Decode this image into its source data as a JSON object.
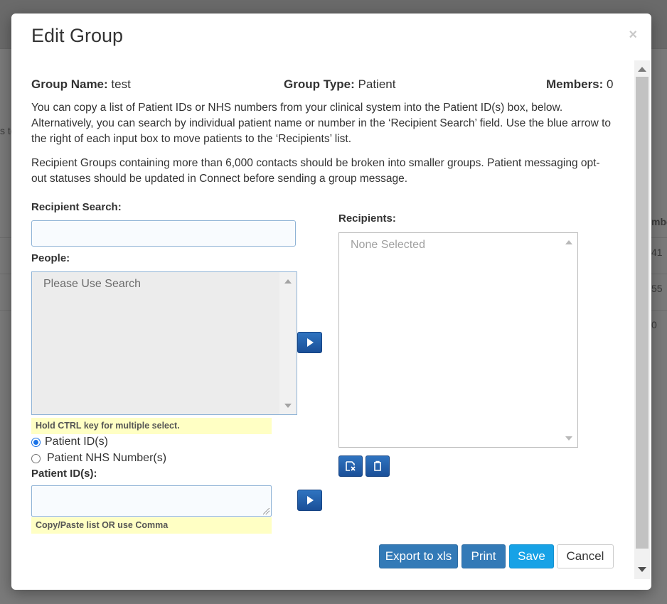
{
  "background": {
    "fragments": [
      "s to",
      "mbe",
      "41",
      "55",
      "0"
    ]
  },
  "modal": {
    "title": "Edit Group",
    "close_glyph": "×"
  },
  "group_info": {
    "name_label": "Group Name:",
    "name_value": "test",
    "type_label": "Group Type:",
    "type_value": "Patient",
    "members_label": "Members:",
    "members_value": "0"
  },
  "instructions": {
    "paragraph1": "You can copy a list of Patient IDs or NHS numbers from your clinical system into the Patient ID(s) box, below. Alternatively, you can search by individual patient name or number in the ‘Recipient Search’ field. Use the blue arrow to the right of each input box to move patients to the ‘Recipients’ list.",
    "paragraph2": "Recipient Groups containing more than 6,000 contacts should be broken into smaller groups. Patient messaging opt-out statuses should be updated in Connect before sending a group message."
  },
  "recipient_search": {
    "label": "Recipient Search:",
    "value": "",
    "placeholder": ""
  },
  "people": {
    "label": "People:",
    "placeholder": "Please Use Search",
    "hint": "Hold CTRL key for multiple select."
  },
  "id_type": {
    "options": [
      {
        "label": "Patient ID(s)",
        "checked": true
      },
      {
        "label": "Patient NHS Number(s)",
        "checked": false
      }
    ]
  },
  "patient_ids": {
    "label": "Patient ID(s):",
    "value": "",
    "hint": "Copy/Paste list OR use Comma"
  },
  "recipients": {
    "label": "Recipients:",
    "placeholder": "None Selected"
  },
  "footer": {
    "export_label": "Export to xls",
    "print_label": "Print",
    "save_label": "Save",
    "cancel_label": "Cancel"
  },
  "icons": {
    "move_people": "play-arrow-icon",
    "move_ids": "play-arrow-icon",
    "remove_selected": "remove-selected-icon",
    "clear_all": "trash-icon"
  },
  "colors": {
    "primary": "#337ab7",
    "info": "#17a2e6",
    "arrow_button": "#1a4f98",
    "hint_background": "#ffffc4"
  }
}
